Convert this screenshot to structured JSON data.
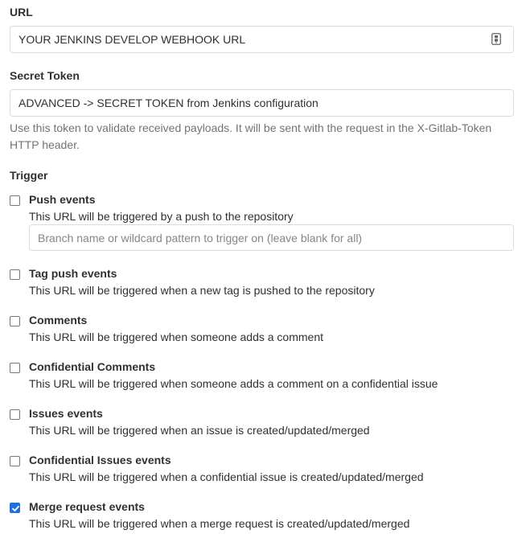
{
  "url_field": {
    "label": "URL",
    "value": "YOUR JENKINS DEVELOP WEBHOOK URL",
    "icon": "password-key-icon"
  },
  "secret_token": {
    "label": "Secret Token",
    "value": "ADVANCED -> SECRET TOKEN from Jenkins configuration",
    "help": "Use this token to validate received payloads. It will be sent with the request in the X-Gitlab-Token HTTP header."
  },
  "trigger": {
    "label": "Trigger",
    "branch_placeholder": "Branch name or wildcard pattern to trigger on (leave blank for all)",
    "items": [
      {
        "title": "Push events",
        "description": "This URL will be triggered by a push to the repository",
        "checked": false
      },
      {
        "title": "Tag push events",
        "description": "This URL will be triggered when a new tag is pushed to the repository",
        "checked": false
      },
      {
        "title": "Comments",
        "description": "This URL will be triggered when someone adds a comment",
        "checked": false
      },
      {
        "title": "Confidential Comments",
        "description": "This URL will be triggered when someone adds a comment on a confidential issue",
        "checked": false
      },
      {
        "title": "Issues events",
        "description": "This URL will be triggered when an issue is created/updated/merged",
        "checked": false
      },
      {
        "title": "Confidential Issues events",
        "description": "This URL will be triggered when a confidential issue is created/updated/merged",
        "checked": false
      },
      {
        "title": "Merge request events",
        "description": "This URL will be triggered when a merge request is created/updated/merged",
        "checked": true
      }
    ]
  },
  "colors": {
    "checkbox_checked": "#1f6fe0",
    "input_border": "#dbdbdb",
    "help_text": "#737278"
  }
}
